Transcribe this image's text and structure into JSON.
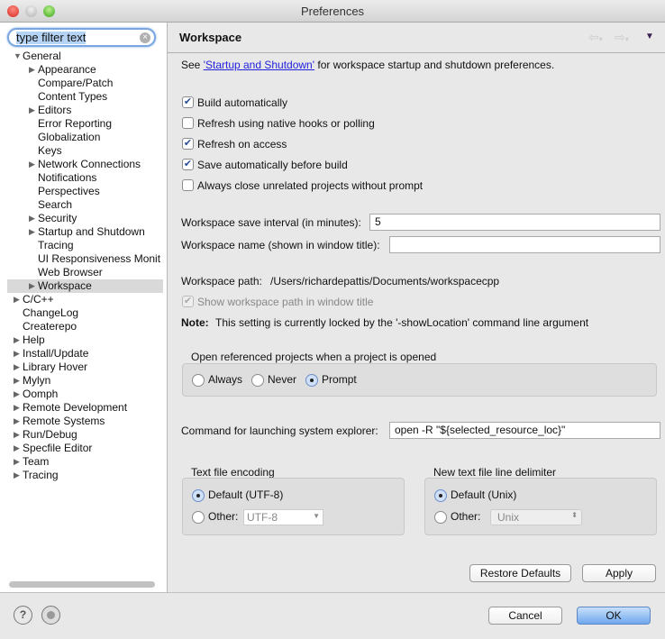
{
  "window": {
    "title": "Preferences"
  },
  "filter": {
    "value": "type filter text"
  },
  "tree": [
    {
      "label": "General",
      "level": 0,
      "expander": "open"
    },
    {
      "label": "Appearance",
      "level": 1,
      "expander": "closed"
    },
    {
      "label": "Compare/Patch",
      "level": 1,
      "expander": "none"
    },
    {
      "label": "Content Types",
      "level": 1,
      "expander": "none"
    },
    {
      "label": "Editors",
      "level": 1,
      "expander": "closed"
    },
    {
      "label": "Error Reporting",
      "level": 1,
      "expander": "none"
    },
    {
      "label": "Globalization",
      "level": 1,
      "expander": "none"
    },
    {
      "label": "Keys",
      "level": 1,
      "expander": "none"
    },
    {
      "label": "Network Connections",
      "level": 1,
      "expander": "closed"
    },
    {
      "label": "Notifications",
      "level": 1,
      "expander": "none"
    },
    {
      "label": "Perspectives",
      "level": 1,
      "expander": "none"
    },
    {
      "label": "Search",
      "level": 1,
      "expander": "none"
    },
    {
      "label": "Security",
      "level": 1,
      "expander": "closed"
    },
    {
      "label": "Startup and Shutdown",
      "level": 1,
      "expander": "closed"
    },
    {
      "label": "Tracing",
      "level": 1,
      "expander": "none"
    },
    {
      "label": "UI Responsiveness Monit",
      "level": 1,
      "expander": "none"
    },
    {
      "label": "Web Browser",
      "level": 1,
      "expander": "none"
    },
    {
      "label": "Workspace",
      "level": 1,
      "expander": "closed",
      "selected": true
    },
    {
      "label": "C/C++",
      "level": 0,
      "expander": "closed"
    },
    {
      "label": "ChangeLog",
      "level": 0,
      "expander": "none"
    },
    {
      "label": "Createrepo",
      "level": 0,
      "expander": "none"
    },
    {
      "label": "Help",
      "level": 0,
      "expander": "closed"
    },
    {
      "label": "Install/Update",
      "level": 0,
      "expander": "closed"
    },
    {
      "label": "Library Hover",
      "level": 0,
      "expander": "closed"
    },
    {
      "label": "Mylyn",
      "level": 0,
      "expander": "closed"
    },
    {
      "label": "Oomph",
      "level": 0,
      "expander": "closed"
    },
    {
      "label": "Remote Development",
      "level": 0,
      "expander": "closed"
    },
    {
      "label": "Remote Systems",
      "level": 0,
      "expander": "closed"
    },
    {
      "label": "Run/Debug",
      "level": 0,
      "expander": "closed"
    },
    {
      "label": "Specfile Editor",
      "level": 0,
      "expander": "closed"
    },
    {
      "label": "Team",
      "level": 0,
      "expander": "closed"
    },
    {
      "label": "Tracing",
      "level": 0,
      "expander": "closed"
    }
  ],
  "page": {
    "title": "Workspace",
    "intro_pre": "See ",
    "intro_link": "'Startup and Shutdown'",
    "intro_post": " for workspace startup and shutdown preferences.",
    "checkboxes": [
      {
        "label": "Build automatically",
        "checked": true
      },
      {
        "label": "Refresh using native hooks or polling",
        "checked": false
      },
      {
        "label": "Refresh on access",
        "checked": true
      },
      {
        "label": "Save automatically before build",
        "checked": true
      },
      {
        "label": "Always close unrelated projects without prompt",
        "checked": false
      }
    ],
    "save_interval_label": "Workspace save interval (in minutes):",
    "save_interval_value": "5",
    "name_label": "Workspace name (shown in window title):",
    "name_value": "",
    "path_label": "Workspace path:",
    "path_value": "/Users/richardepattis/Documents/workspacecpp",
    "show_path_label": "Show workspace path in window title",
    "note_label": "Note:",
    "note_text": "This setting is currently locked by the '-showLocation' command line argument",
    "open_ref_title": "Open referenced projects when a project is opened",
    "open_ref_options": [
      "Always",
      "Never",
      "Prompt"
    ],
    "open_ref_selected": "Prompt",
    "explorer_label": "Command for launching system explorer:",
    "explorer_value": "open -R \"${selected_resource_loc}\"",
    "encoding_title": "Text file encoding",
    "encoding_default": "Default (UTF-8)",
    "encoding_other": "Other:",
    "encoding_other_value": "UTF-8",
    "delim_title": "New text file line delimiter",
    "delim_default": "Default (Unix)",
    "delim_other": "Other:",
    "delim_other_value": "Unix",
    "restore_defaults": "Restore Defaults",
    "apply": "Apply"
  },
  "footer": {
    "cancel": "Cancel",
    "ok": "OK"
  },
  "colors": {
    "accent": "#3b6fd4",
    "link": "#2222dd"
  }
}
